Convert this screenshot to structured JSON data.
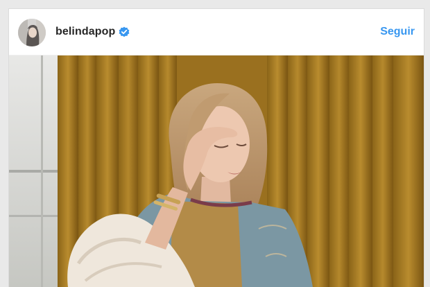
{
  "post": {
    "username": "belindapop",
    "verified": true,
    "follow_label": "Seguir",
    "accent_color": "#3897f0",
    "verified_icon": "verified-badge-icon"
  }
}
